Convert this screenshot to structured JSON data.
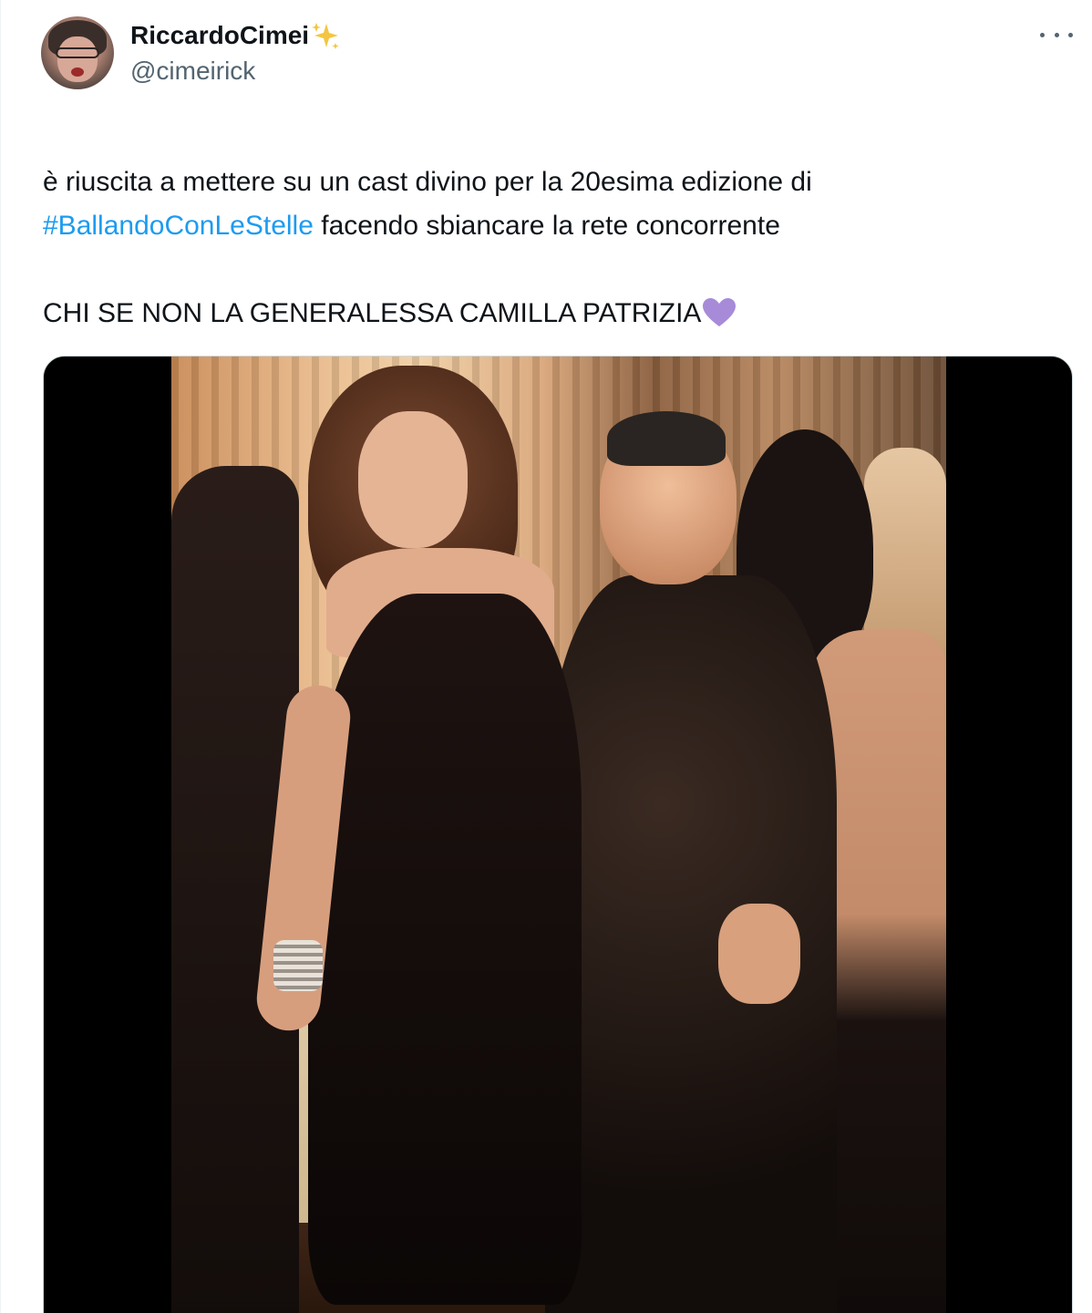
{
  "tweet": {
    "author": {
      "display_name": "RiccardoCimei",
      "display_name_emoji": "sparkles-icon",
      "handle": "@cimeirick",
      "avatar": "avatar-photo"
    },
    "more_icon": "more-horizontal-icon",
    "text": {
      "line1": "è riuscita a mettere su un cast divino per la 20esima edizione di",
      "hashtag": "#BallandoConLeStelle",
      "line2_rest": " facendo sbiancare la rete concorrente",
      "line3": "CHI SE NON LA GENERALESSA CAMILLA PATRIZIA",
      "line3_emoji": "purple-heart-icon"
    },
    "media": {
      "type": "video",
      "content": "video-still-dancers"
    }
  },
  "colors": {
    "text_primary": "#0f1419",
    "text_secondary": "#536471",
    "link": "#1d9bf0",
    "border": "#cfd9de",
    "heart": "#a78bd8",
    "sparkle": "#f4c542"
  }
}
